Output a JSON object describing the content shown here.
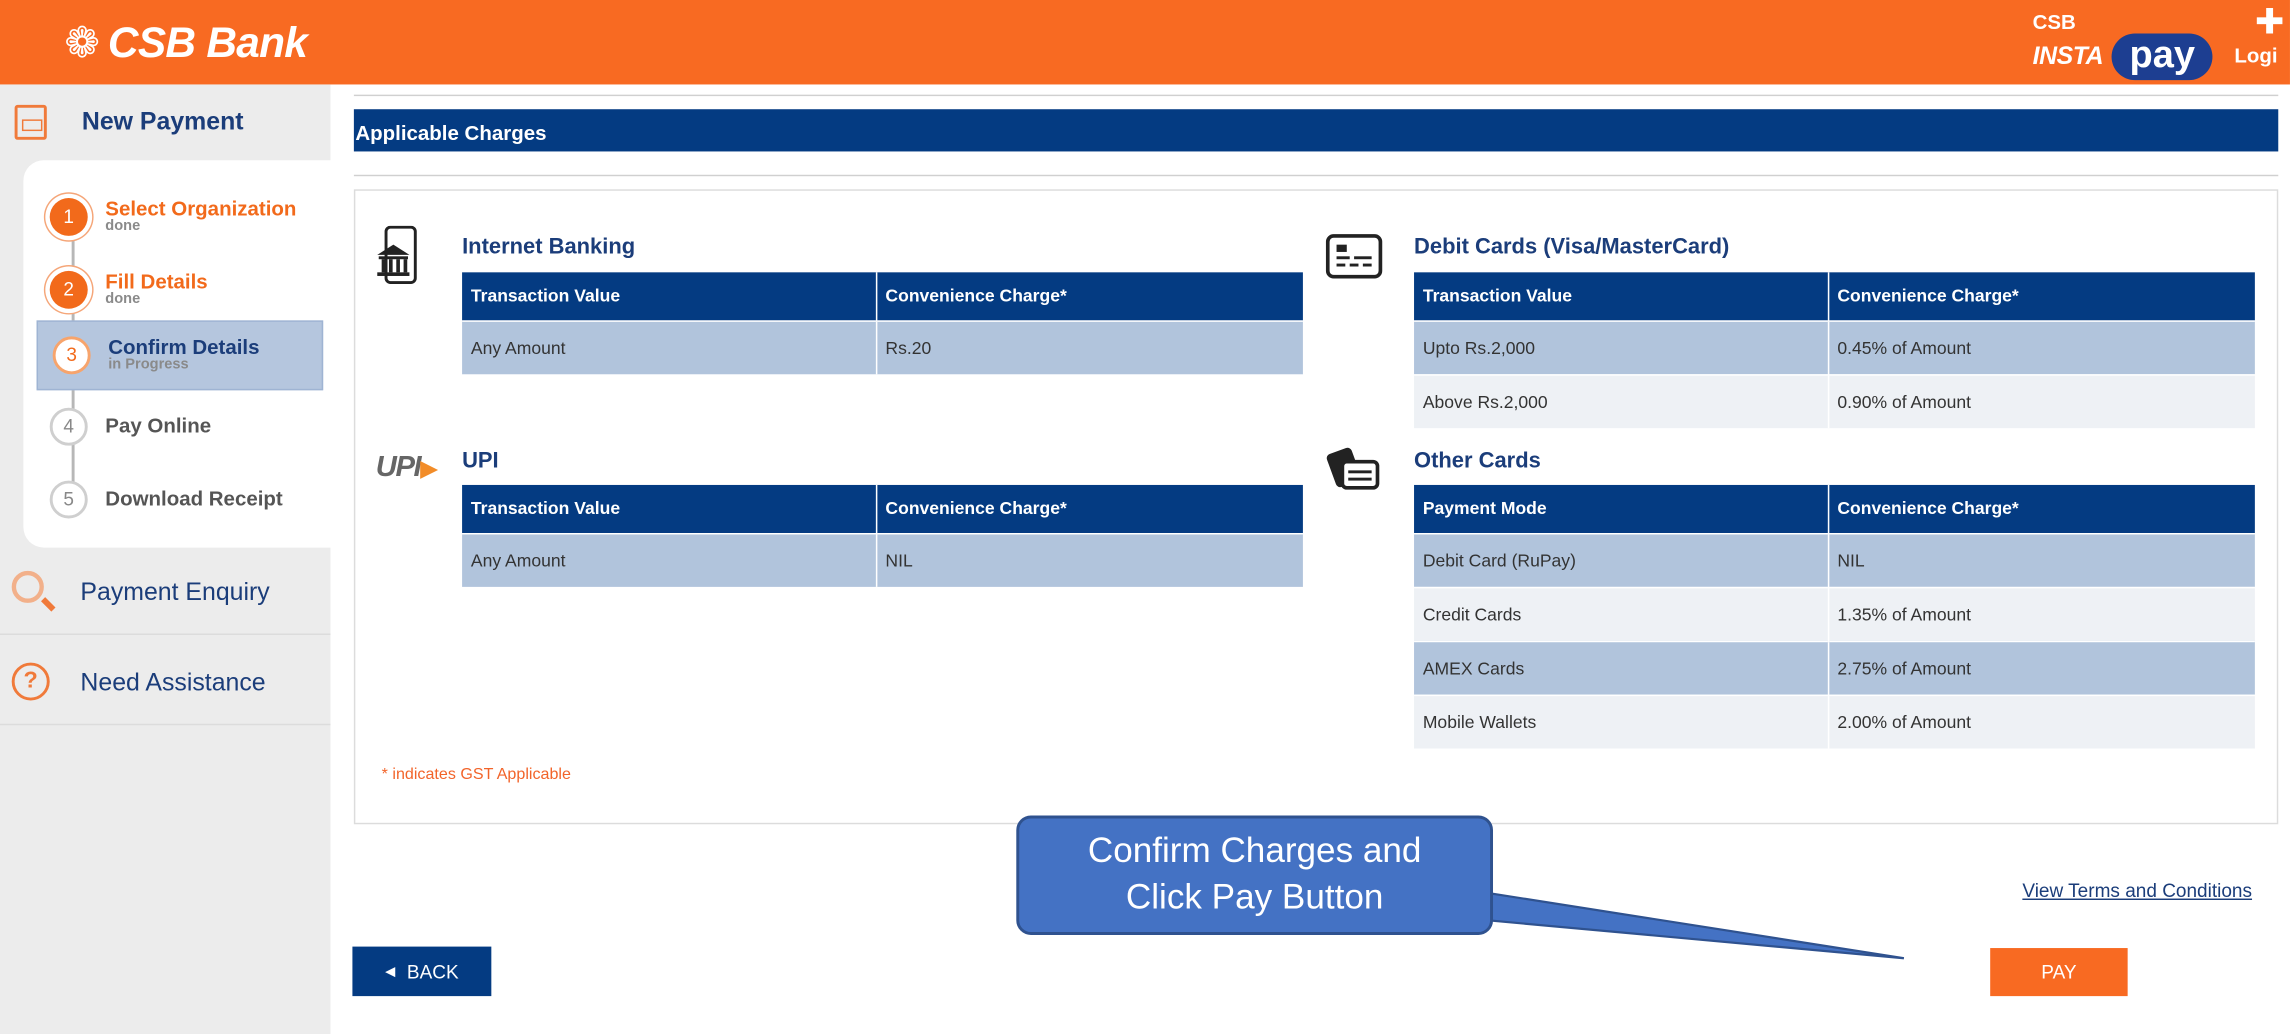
{
  "header": {
    "brand": "CSB Bank",
    "insta_csb": "CSB",
    "insta_word": "INSTA",
    "insta_pay": "pay",
    "login": "Logi"
  },
  "sidebar": {
    "new_payment": "New Payment",
    "steps": [
      {
        "num": "1",
        "title": "Select Organization",
        "status": "done"
      },
      {
        "num": "2",
        "title": "Fill Details",
        "status": "done"
      },
      {
        "num": "3",
        "title": "Confirm Details",
        "status": "in Progress"
      },
      {
        "num": "4",
        "title": "Pay Online",
        "status": ""
      },
      {
        "num": "5",
        "title": "Download Receipt",
        "status": ""
      }
    ],
    "payment_enquiry": "Payment Enquiry",
    "need_assistance": "Need Assistance"
  },
  "main": {
    "section_title": "Applicable Charges",
    "internet_banking": {
      "title": "Internet Banking",
      "headers": [
        "Transaction Value",
        "Convenience Charge*"
      ],
      "rows": [
        [
          "Any Amount",
          "Rs.20"
        ]
      ]
    },
    "upi": {
      "title": "UPI",
      "logo_text": "UPI",
      "headers": [
        "Transaction Value",
        "Convenience Charge*"
      ],
      "rows": [
        [
          "Any Amount",
          "NIL"
        ]
      ]
    },
    "debit_cards": {
      "title": "Debit Cards (Visa/MasterCard)",
      "headers": [
        "Transaction Value",
        "Convenience Charge*"
      ],
      "rows": [
        [
          "Upto Rs.2,000",
          "0.45% of Amount"
        ],
        [
          "Above Rs.2,000",
          "0.90% of Amount"
        ]
      ]
    },
    "other_cards": {
      "title": "Other Cards",
      "headers": [
        "Payment Mode",
        "Convenience Charge*"
      ],
      "rows": [
        [
          "Debit Card (RuPay)",
          "NIL"
        ],
        [
          "Credit Cards",
          "1.35% of Amount"
        ],
        [
          "AMEX Cards",
          "2.75% of Amount"
        ],
        [
          "Mobile Wallets",
          "2.00% of Amount"
        ]
      ]
    },
    "gst_note": "* indicates GST Applicable",
    "terms_link": "View Terms and Conditions",
    "back_button": "BACK",
    "pay_button": "PAY"
  },
  "callout": {
    "line1": "Confirm Charges and",
    "line2": "Click Pay Button"
  },
  "colors": {
    "brand_orange": "#f86a22",
    "navy": "#043b82",
    "row_dark": "#b1c4dc",
    "row_light": "#eef1f5",
    "callout_blue": "#4472c4"
  }
}
